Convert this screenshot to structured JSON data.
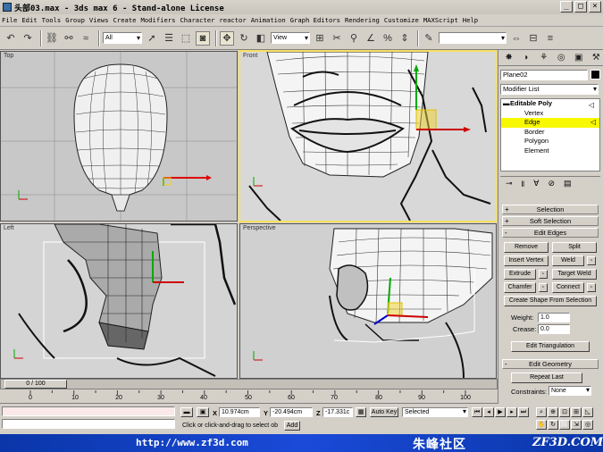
{
  "window": {
    "title": "头部03.max - 3ds max 6 - Stand-alone License",
    "controls": [
      "_",
      "□",
      "×"
    ]
  },
  "menu": [
    "File",
    "Edit",
    "Tools",
    "Group",
    "Views",
    "Create",
    "Modifiers",
    "Character",
    "reactor",
    "Animation",
    "Graph Editors",
    "Rendering",
    "Customize",
    "MAXScript",
    "Help"
  ],
  "toolbar": {
    "selection_filter": "All",
    "reference_coord": "View",
    "named_selection": ""
  },
  "viewports": {
    "top": {
      "label": "Top"
    },
    "front": {
      "label": "Front"
    },
    "left": {
      "label": "Left"
    },
    "perspective": {
      "label": "Perspective"
    }
  },
  "command_panel": {
    "object_name": "Plane02",
    "object_color": "#000000",
    "modifier_list": "Modifier List",
    "stack": {
      "root": "Editable Poly",
      "items": [
        "Vertex",
        "Edge",
        "Border",
        "Polygon",
        "Element"
      ],
      "selected_index": 1
    },
    "rollouts": {
      "selection": "Selection",
      "soft_selection": "Soft Selection",
      "edit_edges": "Edit Edges",
      "edit_geometry": "Edit Geometry"
    },
    "buttons": {
      "remove": "Remove",
      "split": "Split",
      "insert_vertex": "Insert Vertex",
      "weld": "Weld",
      "extrude": "Extrude",
      "target_weld": "Target Weld",
      "chamfer": "Chamfer",
      "connect": "Connect",
      "create_shape": "Create Shape From Selection",
      "edit_triangulation": "Edit Triangulation",
      "repeat_last": "Repeat Last"
    },
    "weight_label": "Weight:",
    "weight_value": "1.0",
    "crease_label": "Crease:",
    "crease_value": "0.0",
    "constraints_label": "Constraints:",
    "constraints_value": "None"
  },
  "timeline": {
    "slider_text": "0 / 100",
    "ticks": [
      0,
      10,
      20,
      30,
      40,
      50,
      60,
      70,
      80,
      90,
      100
    ]
  },
  "status": {
    "x_label": "X",
    "x_value": "10.974cm",
    "y_label": "Y",
    "y_value": "-20.494cm",
    "z_label": "Z",
    "z_value": "-17.331c",
    "prompt": "Click or click-and-drag to select ob",
    "add_button": "Add",
    "auto_key": "Auto Key",
    "selected_dropdown": "Selected"
  },
  "watermark": {
    "url": "http://www.zf3d.com",
    "site_name_cn": "朱峰社区",
    "brand": "ZF3D.COM"
  }
}
